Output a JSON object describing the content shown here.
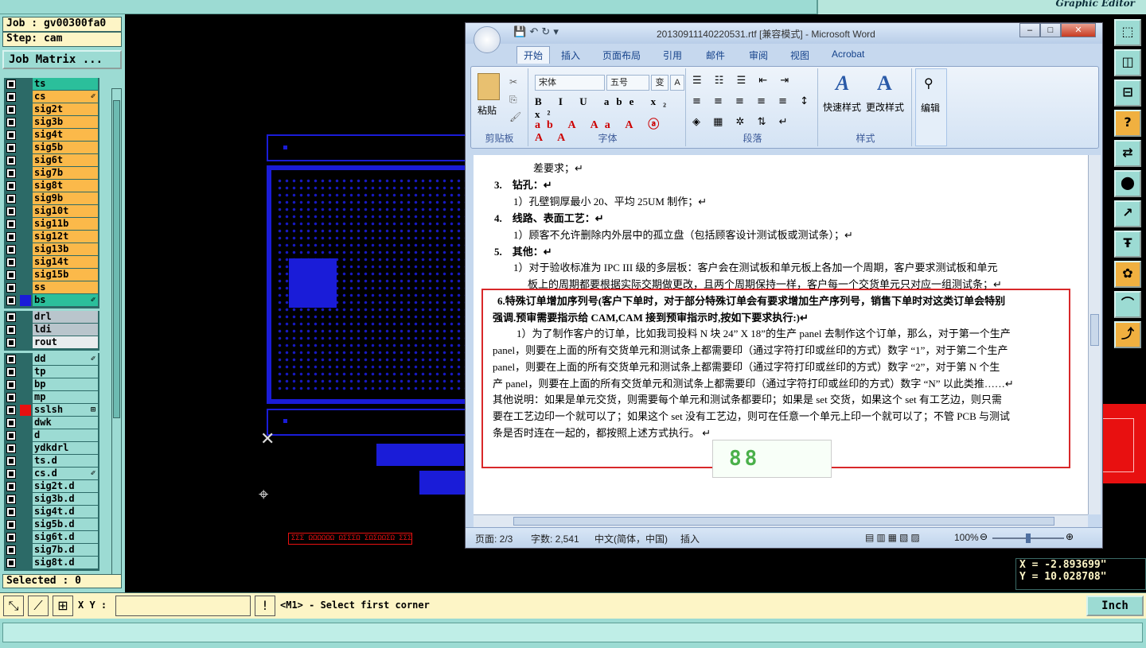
{
  "app": {
    "subtitle": "Graphic Editor"
  },
  "left": {
    "job": "Job : gv00300fa0",
    "step": "Step: cam",
    "job_matrix": "Job Matrix ...",
    "groups": [
      {
        "rows": [
          {
            "name": "ts",
            "color": "#2bbf9b",
            "swatch": "#2c6a67",
            "mark": ""
          },
          {
            "name": "cs",
            "color": "#fbb94a",
            "swatch": "#2c6a67",
            "mark": "✐"
          },
          {
            "name": "sig2t",
            "color": "#fbb94a",
            "swatch": "#2c6a67",
            "mark": ""
          },
          {
            "name": "sig3b",
            "color": "#fbb94a",
            "swatch": "#2c6a67",
            "mark": ""
          },
          {
            "name": "sig4t",
            "color": "#fbb94a",
            "swatch": "#2c6a67",
            "mark": ""
          },
          {
            "name": "sig5b",
            "color": "#fbb94a",
            "swatch": "#2c6a67",
            "mark": ""
          },
          {
            "name": "sig6t",
            "color": "#fbb94a",
            "swatch": "#2c6a67",
            "mark": ""
          },
          {
            "name": "sig7b",
            "color": "#fbb94a",
            "swatch": "#2c6a67",
            "mark": ""
          },
          {
            "name": "sig8t",
            "color": "#fbb94a",
            "swatch": "#2c6a67",
            "mark": ""
          },
          {
            "name": "sig9b",
            "color": "#fbb94a",
            "swatch": "#2c6a67",
            "mark": ""
          },
          {
            "name": "sig10t",
            "color": "#fbb94a",
            "swatch": "#2c6a67",
            "mark": ""
          },
          {
            "name": "sig11b",
            "color": "#fbb94a",
            "swatch": "#2c6a67",
            "mark": ""
          },
          {
            "name": "sig12t",
            "color": "#fbb94a",
            "swatch": "#2c6a67",
            "mark": ""
          },
          {
            "name": "sig13b",
            "color": "#fbb94a",
            "swatch": "#2c6a67",
            "mark": ""
          },
          {
            "name": "sig14t",
            "color": "#fbb94a",
            "swatch": "#2c6a67",
            "mark": ""
          },
          {
            "name": "sig15b",
            "color": "#fbb94a",
            "swatch": "#2c6a67",
            "mark": ""
          },
          {
            "name": "ss",
            "color": "#fbb94a",
            "swatch": "#2c6a67",
            "mark": ""
          },
          {
            "name": "bs",
            "color": "#2bbf9b",
            "swatch": "#1a1cd8",
            "mark": "✐"
          }
        ]
      },
      {
        "rows": [
          {
            "name": "drl",
            "color": "#b9c5cc",
            "swatch": "#2c6a67",
            "mark": ""
          },
          {
            "name": "ldi",
            "color": "#b9c5cc",
            "swatch": "#2c6a67",
            "mark": ""
          },
          {
            "name": "rout",
            "color": "#e8ecee",
            "swatch": "#2c6a67",
            "mark": ""
          }
        ]
      },
      {
        "rows": [
          {
            "name": "dd",
            "color": "#9cdbd3",
            "swatch": "#2c6a67",
            "mark": "✐"
          },
          {
            "name": "tp",
            "color": "#9cdbd3",
            "swatch": "#2c6a67",
            "mark": ""
          },
          {
            "name": "bp",
            "color": "#9cdbd3",
            "swatch": "#2c6a67",
            "mark": ""
          },
          {
            "name": "mp",
            "color": "#9cdbd3",
            "swatch": "#2c6a67",
            "mark": ""
          },
          {
            "name": "sslsh",
            "color": "#9cdbd3",
            "swatch": "#e81010",
            "mark": "⊞"
          },
          {
            "name": "dwk",
            "color": "#9cdbd3",
            "swatch": "#2c6a67",
            "mark": ""
          },
          {
            "name": "d",
            "color": "#9cdbd3",
            "swatch": "#2c6a67",
            "mark": ""
          },
          {
            "name": "ydkdrl",
            "color": "#9cdbd3",
            "swatch": "#2c6a67",
            "mark": ""
          },
          {
            "name": "ts.d",
            "color": "#9cdbd3",
            "swatch": "#2c6a67",
            "mark": ""
          },
          {
            "name": "cs.d",
            "color": "#9cdbd3",
            "swatch": "#2c6a67",
            "mark": "✐"
          },
          {
            "name": "sig2t.d",
            "color": "#9cdbd3",
            "swatch": "#2c6a67",
            "mark": ""
          },
          {
            "name": "sig3b.d",
            "color": "#9cdbd3",
            "swatch": "#2c6a67",
            "mark": ""
          },
          {
            "name": "sig4t.d",
            "color": "#9cdbd3",
            "swatch": "#2c6a67",
            "mark": ""
          },
          {
            "name": "sig5b.d",
            "color": "#9cdbd3",
            "swatch": "#2c6a67",
            "mark": ""
          },
          {
            "name": "sig6t.d",
            "color": "#9cdbd3",
            "swatch": "#2c6a67",
            "mark": ""
          },
          {
            "name": "sig7b.d",
            "color": "#9cdbd3",
            "swatch": "#2c6a67",
            "mark": ""
          },
          {
            "name": "sig8t.d",
            "color": "#9cdbd3",
            "swatch": "#2c6a67",
            "mark": ""
          }
        ]
      }
    ],
    "selected": "Selected : 0"
  },
  "word": {
    "title": "20130911140220531.rtf [兼容模式] - Microsoft Word",
    "tabs": [
      "开始",
      "插入",
      "页面布局",
      "引用",
      "邮件",
      "审阅",
      "视图",
      "Acrobat"
    ],
    "font_name": "宋体",
    "font_size": "五号",
    "groups": {
      "clipboard": "剪贴板",
      "font": "字体",
      "paragraph": "段落",
      "styles": "样式"
    },
    "paste": "粘贴",
    "quick_styles": "快速样式",
    "change_styles": "更改样式",
    "edit": "编辑",
    "doc_lines": [
      "差要求；↵",
      "3.　钻孔：↵",
      "1）孔壁铜厚最小 20、平均 25UM 制作；↵",
      "4.　线路、表面工艺：↵",
      "1）顾客不允许删除内外层中的孤立盘（包括顾客设计测试板或测试条）；↵",
      "5.　其他：↵",
      "1）对于验收标准为 IPC III 级的多层板：客户会在测试板和单元板上各加一个周期，客户要求测试板和单元",
      "板上的周期都要根据实际交期做更改，且两个周期保持一样，客户每一个交货单元只对应一组测试条；↵",
      "6.特殊订单增加序列号(客户下单时，对于部分特殊订单会有要求增加生产序列号，销售下单时对这类订单会特别",
      "强调.预审需要指示给 CAM,CAM 接到预审指示时,按如下要求执行:)↵",
      "1）为了制作客户的订单，比如我司投料 N 块 24” X 18”的生产 panel 去制作这个订单，那么，对于第一个生产",
      "panel，则要在上面的所有交货单元和测试条上都需要印（通过字符打印或丝印的方式）数字 “1”，对于第二个生产",
      "panel，则要在上面的所有交货单元和测试条上都需要印（通过字符打印或丝印的方式）数字 “2”，对于第 N 个生",
      "产 panel，则要在上面的所有交货单元和测试条上都需要印（通过字符打印或丝印的方式）数字 “N” 以此类推……↵",
      "其他说明：如果是单元交货，则需要每个单元和测试条都要印；如果是 set 交货，如果这个 set 有工艺边，则只需",
      "要在工艺边印一个就可以了；如果这个 set 没有工艺边，则可在任意一个单元上印一个就可以了；不管 PCB 与测试",
      "条是否时连在一起的，都按照上述方式执行。 ↵"
    ],
    "status": {
      "page": "页面: 2/3",
      "words": "字数: 2,541",
      "lang": "中文(简体，中国)",
      "mode": "插入",
      "zoom": "100%"
    }
  },
  "right_tools": [
    "⬚",
    "◫",
    "⊟",
    "?",
    "⇄",
    "⬤",
    "↗",
    "Ŧ",
    "✿",
    "⌒",
    "⤴"
  ],
  "coords": {
    "x": "X = -2.893699\"",
    "y": "Y = 10.028708\""
  },
  "bottom": {
    "xy_label": "X Y :",
    "xy_value": "",
    "message": "<M1> - Select first corner",
    "units": "Inch"
  },
  "canvas_text": "ΣΣΣ ΩΩΩΩΩΩ ΩΣΣΣΩ ΣΩΣΩΩΣΩ ΣΣΣΣΣ",
  "colors": {
    "accent": "#9cdbd3",
    "pcb": "#1a1cd8",
    "highlight": "#e81010"
  }
}
